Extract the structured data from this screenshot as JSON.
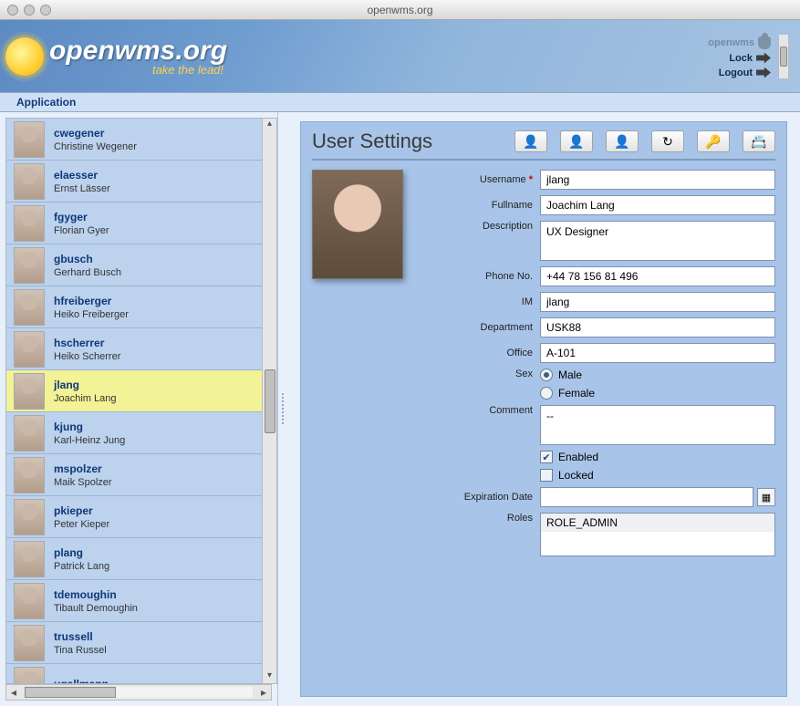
{
  "window_title": "openwms.org",
  "brand": {
    "name": "openwms.org",
    "tagline": "take the lead!"
  },
  "banner_links": {
    "user": "openwms",
    "lock": "Lock",
    "logout": "Logout"
  },
  "menubar": {
    "application": "Application"
  },
  "users": [
    {
      "username": "cwegener",
      "fullname": "Christine Wegener"
    },
    {
      "username": "elaesser",
      "fullname": "Ernst Lässer"
    },
    {
      "username": "fgyger",
      "fullname": "Florian Gyer"
    },
    {
      "username": "gbusch",
      "fullname": "Gerhard Busch"
    },
    {
      "username": "hfreiberger",
      "fullname": "Heiko Freiberger"
    },
    {
      "username": "hscherrer",
      "fullname": "Heiko Scherrer"
    },
    {
      "username": "jlang",
      "fullname": "Joachim Lang",
      "selected": true
    },
    {
      "username": "kjung",
      "fullname": "Karl-Heinz Jung"
    },
    {
      "username": "mspolzer",
      "fullname": "Maik Spolzer"
    },
    {
      "username": "pkieper",
      "fullname": "Peter Kieper"
    },
    {
      "username": "plang",
      "fullname": "Patrick Lang"
    },
    {
      "username": "tdemoughin",
      "fullname": "Tibault Demoughin"
    },
    {
      "username": "trussell",
      "fullname": "Tina Russel"
    },
    {
      "username": "ugallmann",
      "fullname": ""
    }
  ],
  "panel": {
    "title": "User Settings",
    "tools": {
      "add": "add-user",
      "remove": "remove-user",
      "delete": "delete-user",
      "refresh": "refresh",
      "password": "change-password",
      "preferences": "user-preferences"
    },
    "labels": {
      "username": "Username",
      "fullname": "Fullname",
      "description": "Description",
      "phone": "Phone No.",
      "im": "IM",
      "department": "Department",
      "office": "Office",
      "sex": "Sex",
      "male": "Male",
      "female": "Female",
      "comment": "Comment",
      "enabled": "Enabled",
      "locked": "Locked",
      "expiration": "Expiration Date",
      "roles": "Roles"
    },
    "values": {
      "username": "jlang",
      "fullname": "Joachim Lang",
      "description": "UX Designer",
      "phone": "+44 78 156 81 496",
      "im": "jlang",
      "department": "USK88",
      "office": "A-101",
      "sex": "Male",
      "comment": "--",
      "enabled": true,
      "locked": false,
      "expiration": "",
      "roles": [
        "ROLE_ADMIN"
      ]
    }
  }
}
